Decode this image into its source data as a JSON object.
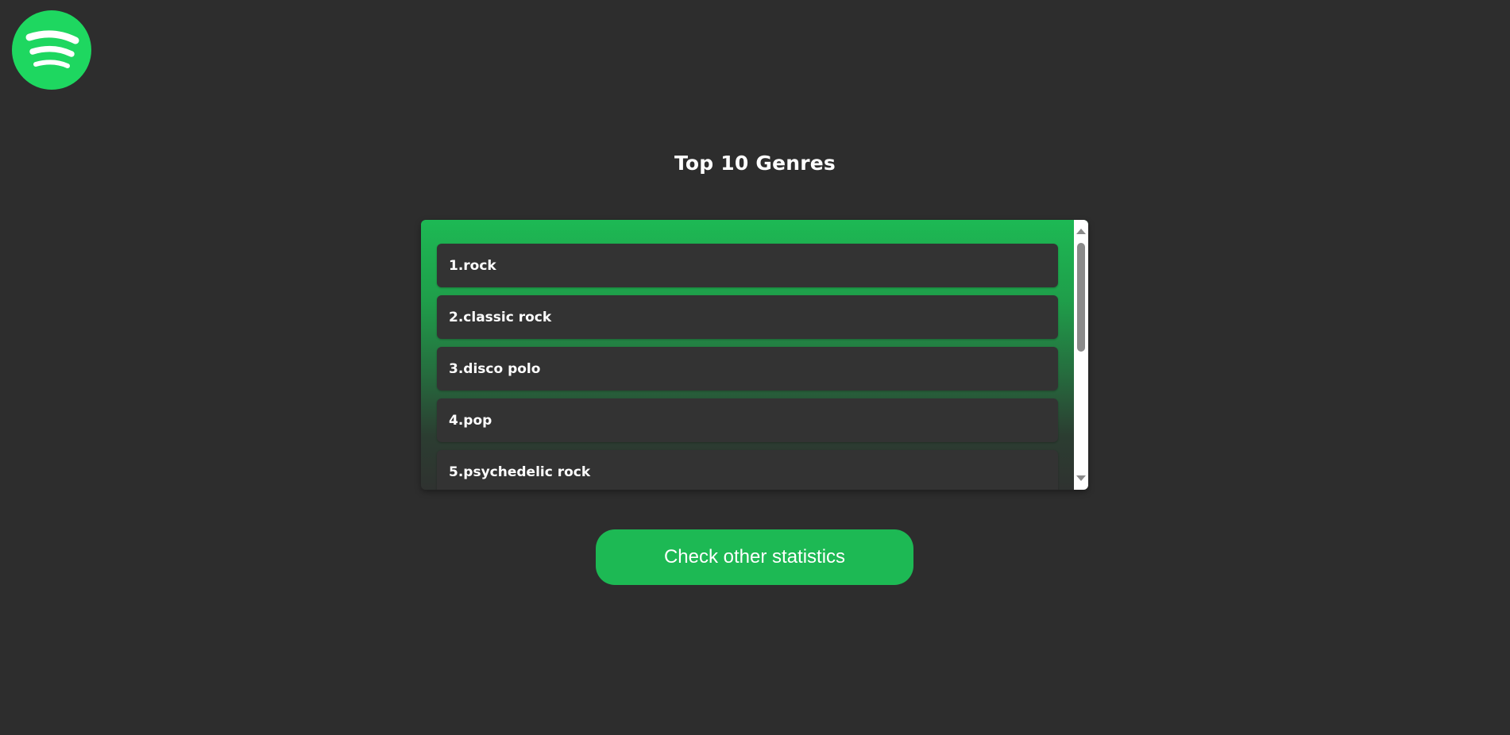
{
  "logo": {
    "icon": "spotify-logo-icon",
    "color": "#1ed760"
  },
  "title": "Top 10 Genres",
  "genres": [
    {
      "label": "1.rock"
    },
    {
      "label": "2.classic rock"
    },
    {
      "label": "3.disco polo"
    },
    {
      "label": "4.pop"
    },
    {
      "label": "5.psychedelic rock"
    }
  ],
  "button": {
    "label": "Check other statistics",
    "color": "#1db954"
  },
  "colors": {
    "background": "#2d2d2d",
    "item": "#333333",
    "accent": "#1db954"
  }
}
